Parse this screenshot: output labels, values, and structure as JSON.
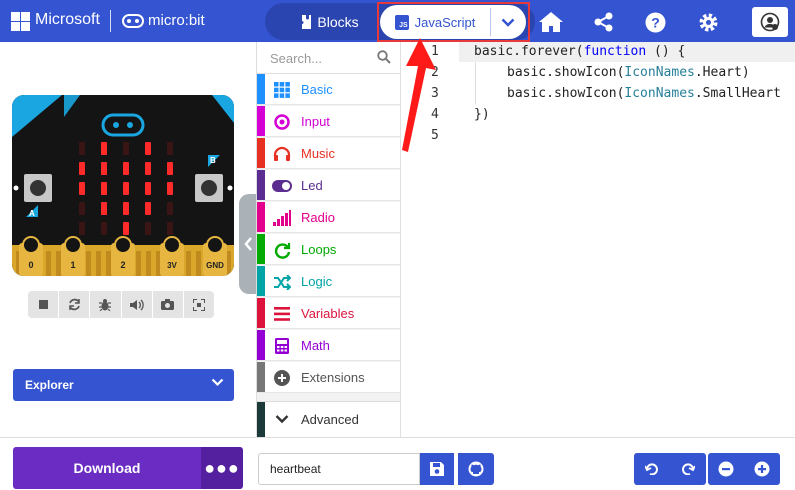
{
  "header": {
    "brand": "Microsoft",
    "product": "micro:bit",
    "tabs": {
      "blocks": "Blocks",
      "javascript": "JavaScript"
    },
    "accent": "#3454d1"
  },
  "simulator": {
    "pins": [
      "0",
      "1",
      "2",
      "3V",
      "GND"
    ],
    "button_labels": [
      "A",
      "B"
    ],
    "led_pattern": [
      [
        0,
        1,
        0,
        1,
        0
      ],
      [
        1,
        1,
        1,
        1,
        1
      ],
      [
        1,
        1,
        1,
        1,
        1
      ],
      [
        0,
        1,
        1,
        1,
        0
      ],
      [
        0,
        0,
        1,
        0,
        0
      ]
    ],
    "controls": [
      "stop-icon",
      "restart-icon",
      "debug-icon",
      "sound-icon",
      "screenshot-icon",
      "fullscreen-icon"
    ]
  },
  "explorer": {
    "label": "Explorer"
  },
  "toolbox": {
    "search_placeholder": "Search...",
    "categories": [
      {
        "label": "Basic",
        "color": "#1e90ff",
        "icon": "grid-icon"
      },
      {
        "label": "Input",
        "color": "#d400d4",
        "icon": "input-icon"
      },
      {
        "label": "Music",
        "color": "#e63022",
        "icon": "headphones-icon"
      },
      {
        "label": "Led",
        "color": "#5c2d91",
        "icon": "toggle-icon"
      },
      {
        "label": "Radio",
        "color": "#e3008c",
        "icon": "signal-icon"
      },
      {
        "label": "Loops",
        "color": "#00aa00",
        "icon": "loop-icon"
      },
      {
        "label": "Logic",
        "color": "#00a4a6",
        "icon": "shuffle-icon"
      },
      {
        "label": "Variables",
        "color": "#dc143c",
        "icon": "lines-icon"
      },
      {
        "label": "Math",
        "color": "#9400d3",
        "icon": "calculator-icon"
      },
      {
        "label": "Extensions",
        "color": "#777777",
        "icon": "plus-circle-icon"
      }
    ],
    "advanced": "Advanced"
  },
  "editor": {
    "line_numbers": [
      "1",
      "2",
      "3",
      "4",
      "5"
    ],
    "lines": {
      "l1_a": "basic.forever(",
      "l1_kw": "function",
      "l1_b": " () {",
      "l2_a": "basic.showIcon(",
      "l2_ty": "IconNames",
      "l2_b": ".Heart)",
      "l3_a": "basic.showIcon(",
      "l3_ty": "IconNames",
      "l3_b": ".SmallHeart",
      "l4": "})"
    }
  },
  "footer": {
    "download": "Download",
    "project_name": "heartbeat"
  }
}
